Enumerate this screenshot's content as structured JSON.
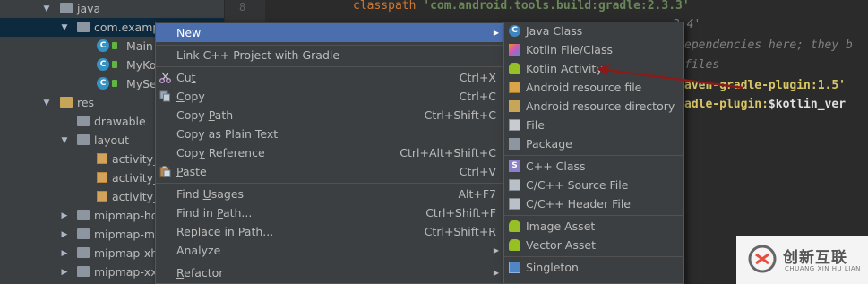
{
  "tree": [
    {
      "label": "java",
      "expanded": true,
      "type": "folder"
    },
    {
      "label": "com.examp",
      "expanded": true,
      "type": "package",
      "selected": true
    },
    {
      "label": "Main",
      "type": "kotlin"
    },
    {
      "label": "MyKo",
      "type": "kotlin"
    },
    {
      "label": "MySe",
      "type": "kotlin"
    },
    {
      "label": "res",
      "expanded": true,
      "type": "res"
    },
    {
      "label": "drawable",
      "type": "folder"
    },
    {
      "label": "layout",
      "expanded": true,
      "type": "folder"
    },
    {
      "label": "activity_",
      "type": "xml"
    },
    {
      "label": "activity_",
      "type": "xml"
    },
    {
      "label": "activity_",
      "type": "xml"
    },
    {
      "label": "mipmap-hd",
      "expanded": false,
      "type": "folder"
    },
    {
      "label": "mipmap-md",
      "expanded": false,
      "type": "folder"
    },
    {
      "label": "mipmap-xh",
      "expanded": false,
      "type": "folder"
    },
    {
      "label": "mipmap-xxl",
      "expanded": false,
      "type": "folder"
    }
  ],
  "gutter": {
    "line_number": "8"
  },
  "editor": {
    "line1_kw": "classpath ",
    "line1_str": "'com.android.tools.build:gradle:2.3.3'",
    "line2_str": "3.4'",
    "line3_cmt": "ependencies here; they b",
    "line4_cmt": "files",
    "line5_str": "aven-gradle-plugin:1.5'",
    "line6_str": "adle-plugin:",
    "line6_plain": "$kotlin_ver"
  },
  "context_menu": {
    "new_label": "New",
    "link_cpp": "Link C++ Project with Gradle",
    "cut": {
      "pre": "Cu",
      "u": "t",
      "post": "",
      "shortcut": "Ctrl+X"
    },
    "copy": {
      "u": "C",
      "post": "opy",
      "shortcut": "Ctrl+C"
    },
    "copy_path": {
      "pre": "Copy ",
      "u": "P",
      "post": "ath",
      "shortcut": "Ctrl+Shift+C"
    },
    "copy_plain": "Copy as Plain Text",
    "copy_ref": {
      "pre": "Cop",
      "u": "y",
      "post": " Reference",
      "shortcut": "Ctrl+Alt+Shift+C"
    },
    "paste": {
      "u": "P",
      "post": "aste",
      "shortcut": "Ctrl+V"
    },
    "find_usages": {
      "pre": "Find ",
      "u": "U",
      "post": "sages",
      "shortcut": "Alt+F7"
    },
    "find_in_path": {
      "pre": "Find in ",
      "u": "P",
      "post": "ath...",
      "shortcut": "Ctrl+Shift+F"
    },
    "replace_in_path": {
      "pre": "Repl",
      "u": "a",
      "post": "ce in Path...",
      "shortcut": "Ctrl+Shift+R"
    },
    "analyze": "Analyze",
    "refactor": {
      "u": "R",
      "post": "efactor"
    }
  },
  "submenu": [
    {
      "label": "Java Class",
      "icon": "java-class-icon"
    },
    {
      "label": "Kotlin File/Class",
      "icon": "kotlin-icon"
    },
    {
      "label": "Kotlin Activity",
      "icon": "android-icon"
    },
    {
      "label": "Android resource file",
      "icon": "resource-file-icon"
    },
    {
      "label": "Android resource directory",
      "icon": "resource-dir-icon"
    },
    {
      "label": "File",
      "icon": "file-icon"
    },
    {
      "label": "Package",
      "icon": "package-icon"
    },
    {
      "label": "C++ Class",
      "icon": "cpp-class-icon"
    },
    {
      "label": "C/C++ Source File",
      "icon": "cpp-source-icon"
    },
    {
      "label": "C/C++ Header File",
      "icon": "cpp-header-icon"
    },
    {
      "label": "Image Asset",
      "icon": "android-icon"
    },
    {
      "label": "Vector Asset",
      "icon": "android-icon"
    },
    {
      "label": "Singleton",
      "icon": "singleton-icon"
    }
  ],
  "watermark": {
    "cn": "创新互联",
    "en": "CHUANG XIN HU LIAN"
  },
  "colors": {
    "highlight": "#4b6eaf",
    "menu_bg": "#3c3f41",
    "editor_bg": "#2b2b2b",
    "annotation_arrow": "#8b1a1a"
  }
}
